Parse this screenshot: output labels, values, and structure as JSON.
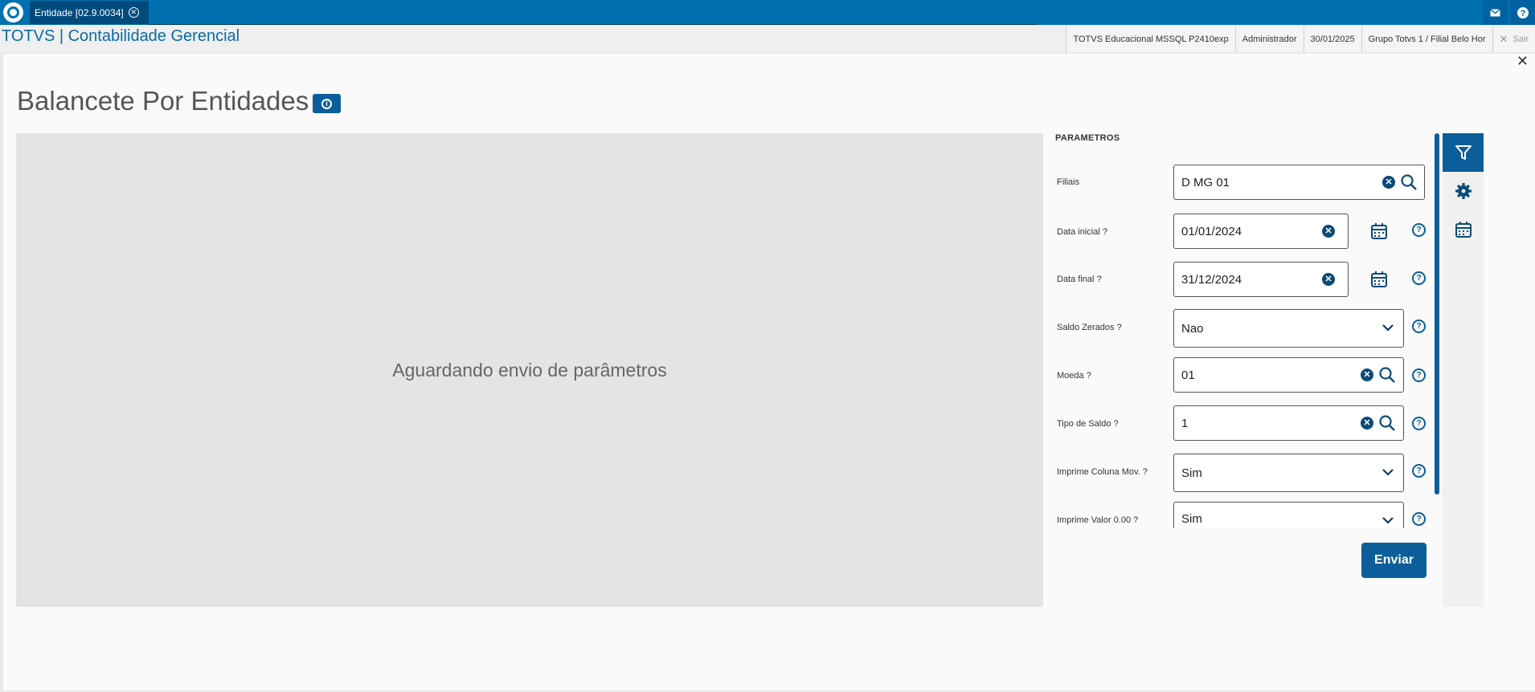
{
  "topbar": {
    "tab_label": "Entidade [02.9.0034]",
    "tab_close": "✕",
    "mail_icon": "mail-icon",
    "help_icon": "help-icon"
  },
  "header": {
    "app_title": "TOTVS | Contabilidade Gerencial",
    "status": [
      "TOTVS Educacional MSSQL P2410exp",
      "Administrador",
      "30/01/2025",
      "Grupo Totvs 1 / Filial Belo Hor"
    ],
    "sair": "Sair"
  },
  "page": {
    "title": "Balancete Por Entidades",
    "preview_text": "Aguardando envio de parâmetros"
  },
  "params": {
    "title": "PARAMETROS",
    "filiais": {
      "label": "Filiais",
      "value": "D MG 01"
    },
    "data_inicial": {
      "label": "Data inicial ?",
      "value": "01/01/2024"
    },
    "data_final": {
      "label": "Data final ?",
      "value": "31/12/2024"
    },
    "saldo_zerados": {
      "label": "Saldo Zerados ?",
      "value": "Nao"
    },
    "moeda": {
      "label": "Moeda ?",
      "value": "01"
    },
    "tipo_saldo": {
      "label": "Tipo de Saldo ?",
      "value": "1"
    },
    "imprime_coluna": {
      "label": "Imprime Coluna Mov. ?",
      "value": "Sim"
    },
    "imprime_valor": {
      "label": "Imprime Valor 0.00 ?",
      "value": "Sim"
    },
    "enviar": "Enviar"
  },
  "colors": {
    "brand": "#0070b0",
    "accent": "#0b5e99"
  }
}
